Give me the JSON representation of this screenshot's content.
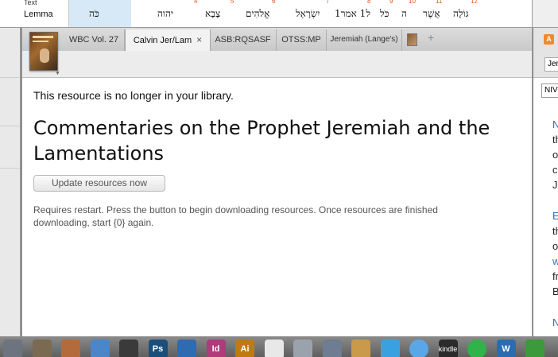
{
  "interlinear": {
    "top_label": "Text",
    "row_label": "Lemma",
    "selected_word": "כֹּה",
    "words": [
      "יהוה",
      "צָבָא",
      "אֱלֹהִים",
      "יִשְׂרָאֵל",
      "ל1 אמר1",
      "כֹּל",
      "ה",
      "אֲשֶׁר",
      "גּוֹלָה"
    ],
    "numbers": [
      "4",
      "5",
      "6",
      "7",
      "8",
      "9",
      "10",
      "11",
      "12"
    ]
  },
  "tabs": [
    {
      "label": "WBC Vol. 27"
    },
    {
      "label": "Calvin Jer/Lam",
      "close": "×"
    },
    {
      "label": "ASB:RQSASF"
    },
    {
      "label": "OTSS:MP"
    },
    {
      "label": "Jeremiah (Lange's)"
    }
  ],
  "tab_add": "+",
  "main": {
    "notice": "This resource is no longer in your library.",
    "title": "Commentaries on the Prophet Jeremiah and the Lamentations",
    "update_button": "Update resources now",
    "restart_text": "Requires restart. Press the button to begin downloading resources. Once resources are finished downloading, start {0} again."
  },
  "right_pane": {
    "icon_letter": "A",
    "input_value": "Jer",
    "select_value": "NIV",
    "lines": [
      {
        "text": "N",
        "style": "blue"
      },
      {
        "text": "th",
        "style": "dark"
      },
      {
        "text": "o",
        "style": "dark"
      },
      {
        "text": "c",
        "style": "dark"
      },
      {
        "text": "J",
        "style": "dark"
      },
      {
        "text": "E",
        "style": "blue"
      },
      {
        "text": "th",
        "style": "dark"
      },
      {
        "text": "o",
        "style": "dark"
      },
      {
        "text": "w",
        "style": "blue"
      },
      {
        "text": "fr",
        "style": "dark"
      },
      {
        "text": "B",
        "style": "dark"
      },
      {
        "text": "N",
        "style": "blue"
      }
    ]
  },
  "dock": {
    "items": [
      {
        "name": "dock-icon-1",
        "label": "",
        "color": "#6d7480"
      },
      {
        "name": "dock-icon-2",
        "label": "",
        "color": "#7a6a52"
      },
      {
        "name": "dock-icon-3",
        "label": "",
        "color": "#b36b3c"
      },
      {
        "name": "dock-icon-4",
        "label": "",
        "color": "#4a86c8"
      },
      {
        "name": "dock-icon-5",
        "label": "",
        "color": "#3a3a3a"
      },
      {
        "name": "photoshop-icon",
        "label": "Ps",
        "color": "#1b4f7a"
      },
      {
        "name": "preview-icon",
        "label": "",
        "color": "#2e6bb0"
      },
      {
        "name": "indesign-icon",
        "label": "Id",
        "color": "#b03a7a"
      },
      {
        "name": "illustrator-icon",
        "label": "Ai",
        "color": "#c07a12"
      },
      {
        "name": "acrobat-icon",
        "label": "",
        "color": "#e8e8e8"
      },
      {
        "name": "dock-icon-11",
        "label": "",
        "color": "#9aa3ad"
      },
      {
        "name": "dock-icon-12",
        "label": "",
        "color": "#6e7d91"
      },
      {
        "name": "dock-icon-13",
        "label": "",
        "color": "#c99a4a"
      },
      {
        "name": "twitter-icon",
        "label": "",
        "color": "#3aa1e0"
      },
      {
        "name": "messages-icon",
        "label": "",
        "color": "#5aa7e8"
      },
      {
        "name": "kindle-icon",
        "label": "kindle",
        "color": "#2b2b2b"
      },
      {
        "name": "spotify-icon",
        "label": "",
        "color": "#2fb34a"
      },
      {
        "name": "w-icon",
        "label": "W",
        "color": "#2b6cb0"
      },
      {
        "name": "dock-icon-19",
        "label": "",
        "color": "#3c9a3c"
      }
    ]
  }
}
